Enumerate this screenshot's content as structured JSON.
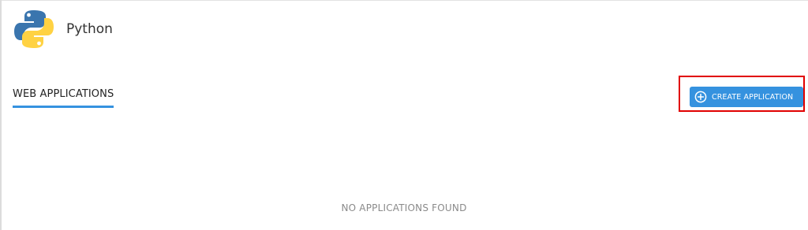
{
  "header": {
    "title": "Python",
    "logo_icon": "python-logo-icon"
  },
  "tabs": [
    {
      "label": "WEB APPLICATIONS",
      "active": true
    }
  ],
  "toolbar": {
    "create_label": "CREATE APPLICATION",
    "create_icon": "plus-circle-icon"
  },
  "main": {
    "empty_message": "NO APPLICATIONS FOUND"
  },
  "colors": {
    "accent": "#3592df",
    "highlight": "#e10000",
    "python_blue": "#3a75ae",
    "python_yellow": "#ffd243"
  }
}
